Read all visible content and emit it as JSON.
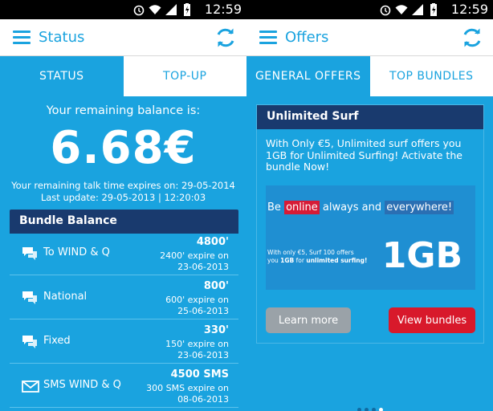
{
  "status_bar": {
    "time": "12:59"
  },
  "left": {
    "appbar": {
      "title": "Status"
    },
    "tabs": [
      {
        "label": "STATUS",
        "active": true
      },
      {
        "label": "TOP-UP",
        "active": false
      }
    ],
    "balance": {
      "caption": "Your remaining balance is:",
      "amount": "6.68€",
      "expires": "Your remaining talk time expires on: 29-05-2014",
      "last_update": "Last update: 29-05-2013 | 12:20:03"
    },
    "bundle_balance": {
      "title": "Bundle Balance",
      "rows": [
        {
          "icon": "chat-bubbles-icon",
          "name": "To WIND & Q",
          "amount": "4800'",
          "expire_line1": "2400' expire on",
          "expire_line2": "23-06-2013"
        },
        {
          "icon": "chat-bubbles-icon",
          "name": "National",
          "amount": "800'",
          "expire_line1": "600' expire on",
          "expire_line2": "25-06-2013"
        },
        {
          "icon": "chat-bubbles-icon",
          "name": "Fixed",
          "amount": "330'",
          "expire_line1": "150' expire on",
          "expire_line2": "23-06-2013"
        },
        {
          "icon": "envelope-icon",
          "name": "SMS WIND & Q",
          "amount": "4500 SMS",
          "expire_line1": "300 SMS expire on",
          "expire_line2": "08-06-2013"
        }
      ]
    }
  },
  "right": {
    "appbar": {
      "title": "Offers"
    },
    "tabs": [
      {
        "label": "GENERAL OFFERS",
        "active": true
      },
      {
        "label": "TOP BUNDLES",
        "active": false
      }
    ],
    "offer": {
      "title": "Unlimited Surf",
      "description": "With Only €5, Unlimited surf offers you 1GB for Unlimited Surfing! Activate the bundle Now!",
      "banner": {
        "be": "Be",
        "online": "online",
        "always_and": "always and",
        "everywhere": "everywhere!",
        "small_line1": "With only €5, Surf 100 offers",
        "small_line2_prefix": "you",
        "small_line2_gb": "1GB",
        "small_line2_for": "for",
        "small_line2_bold": "unlimited surfing!",
        "big": "1GB"
      },
      "learn_more": "Learn more",
      "view_bundles": "View bundles"
    },
    "pager": {
      "count": 4,
      "active_index": 3
    }
  },
  "colors": {
    "brand_blue": "#1aa3df",
    "dark_navy": "#193a6e",
    "red": "#d8192b",
    "grey_button": "#9aa2a8"
  }
}
